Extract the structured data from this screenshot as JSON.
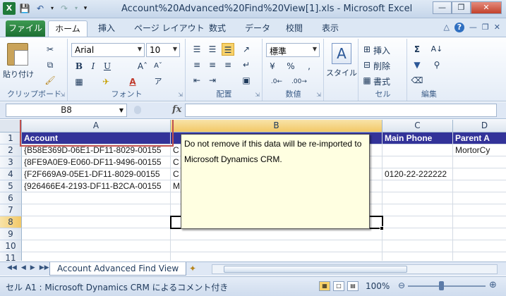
{
  "window": {
    "title": "Account%20Advanced%20Find%20View[1].xls  -  Microsoft Excel"
  },
  "ribbon_tabs": {
    "file": "ファイル",
    "home": "ホーム",
    "insert": "挿入",
    "page_layout": "ページ レイアウト",
    "formulas": "数式",
    "data": "データ",
    "review": "校閲",
    "view": "表示"
  },
  "ribbon": {
    "paste_label": "貼り付け",
    "clipboard_group": "クリップボード",
    "font_name": "Arial",
    "font_size": "10",
    "font_group": "フォント",
    "alignment_group": "配置",
    "number_format": "標準",
    "number_group": "数値",
    "styles_label": "スタイル",
    "insert_label": "挿入",
    "delete_label": "削除",
    "format_label": "書式",
    "cells_group": "セル",
    "editing_group": "編集"
  },
  "formula_bar": {
    "name_box": "B8",
    "fx": "fx",
    "value": ""
  },
  "grid": {
    "columns": [
      "A",
      "B",
      "C",
      "D"
    ],
    "rows": [
      "1",
      "2",
      "3",
      "4",
      "5",
      "6",
      "7",
      "8",
      "9",
      "10",
      "11"
    ],
    "cells": {
      "A1": "Account",
      "C1": "Main Phone",
      "D1": "Parent A",
      "A2": "{B58E369D-06E1-DF11-8029-00155",
      "B2": "C",
      "D2": "MortorCy",
      "A3": "{8FE9A0E9-E060-DF11-9496-00155",
      "B3": "C",
      "A4": "{F2F669A9-05E1-DF11-8029-00155",
      "B4": "C",
      "C4": "0120-22-222222",
      "A5": "{926466E4-2193-DF11-B2CA-00155",
      "B5": "M"
    },
    "comment": "Do not remove if this data will be re-imported to Microsoft Dynamics CRM."
  },
  "sheet_tabs": {
    "active": "Account Advanced Find View"
  },
  "status_bar": {
    "text": "セル A1 : Microsoft Dynamics CRM によるコメント付き",
    "zoom": "100%"
  }
}
